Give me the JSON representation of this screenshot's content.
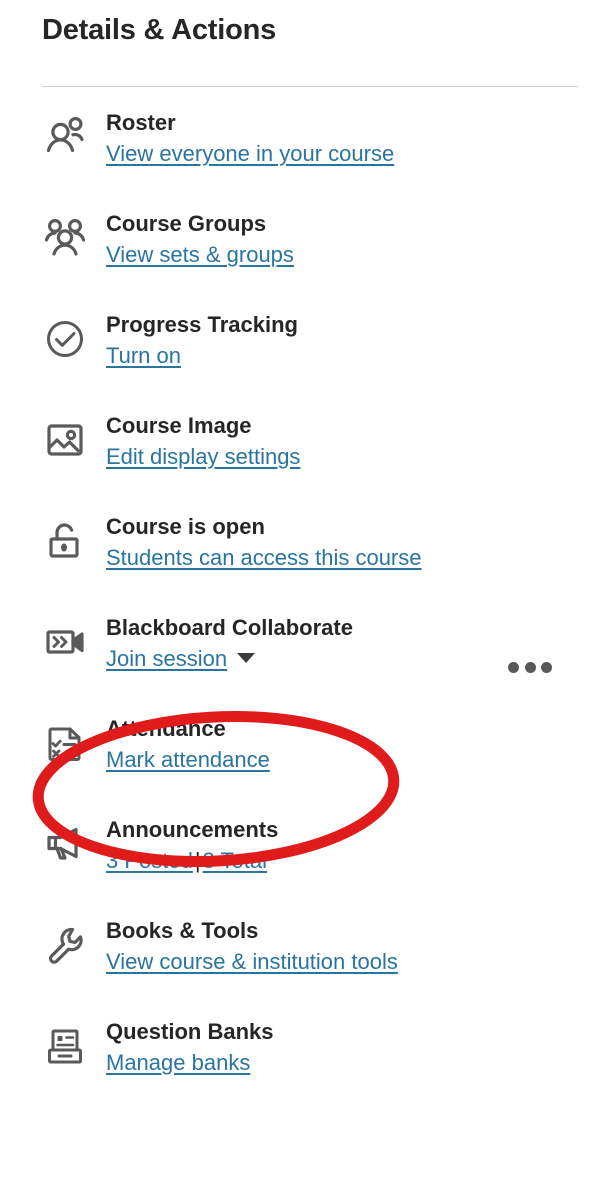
{
  "panel": {
    "title": "Details & Actions"
  },
  "colors": {
    "link": "#2a74a0",
    "title_text": "#262626",
    "icon": "#5a5a5a",
    "divider": "#cfcfcf",
    "annotation": "#e01b1b",
    "background": "#ffffff"
  },
  "items": [
    {
      "icon": "roster-people-icon",
      "title": "Roster",
      "link": "View everyone in your course"
    },
    {
      "icon": "course-groups-people-icon",
      "title": "Course Groups",
      "link": "View sets & groups"
    },
    {
      "icon": "progress-check-circle-icon",
      "title": "Progress Tracking",
      "link": "Turn on"
    },
    {
      "icon": "course-image-picture-icon",
      "title": "Course Image",
      "link": "Edit display settings"
    },
    {
      "icon": "unlock-icon",
      "title": "Course is open",
      "link": "Students can access this course"
    },
    {
      "icon": "video-camera-icon",
      "title": "Blackboard Collaborate",
      "link": "Join session"
    },
    {
      "icon": "attendance-clipboard-icon",
      "title": "Attendance",
      "link": "Mark attendance"
    },
    {
      "icon": "megaphone-icon",
      "title": "Announcements",
      "link": "3 Posted",
      "link_separator": "|",
      "link2": "3 Total"
    },
    {
      "icon": "wrench-icon",
      "title": "Books & Tools",
      "link": "View course & institution tools"
    },
    {
      "icon": "question-banks-icon",
      "title": "Question Banks",
      "link": "Manage banks"
    }
  ],
  "overflow_menu": {
    "icon": "more-options-ellipsis-icon",
    "dots": [
      "dot",
      "dot",
      "dot"
    ]
  },
  "annotation": {
    "shape": "red-ellipse-highlight",
    "targets": "Attendance / Mark attendance"
  }
}
